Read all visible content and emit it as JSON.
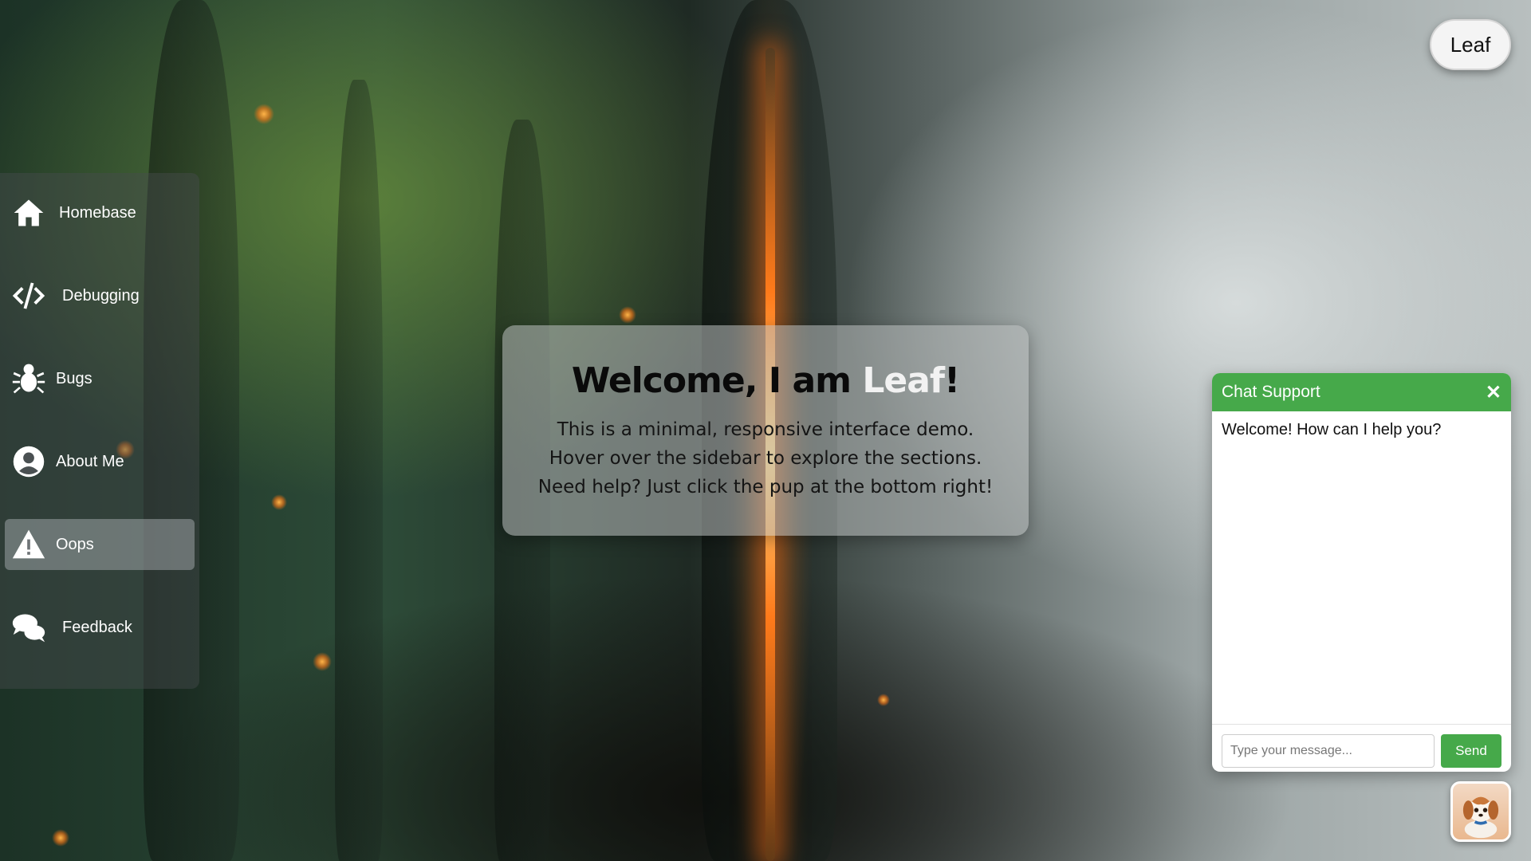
{
  "badge": {
    "label": "Leaf"
  },
  "sidebar": {
    "items": [
      {
        "label": "Homebase",
        "icon": "home-icon"
      },
      {
        "label": "Debugging",
        "icon": "code-icon"
      },
      {
        "label": "Bugs",
        "icon": "bug-icon"
      },
      {
        "label": "About Me",
        "icon": "user-circle-icon"
      },
      {
        "label": "Oops",
        "icon": "warning-icon",
        "active": true
      },
      {
        "label": "Feedback",
        "icon": "comments-icon"
      }
    ]
  },
  "welcome": {
    "title_prefix": "Welcome, I am ",
    "title_highlight": "Leaf",
    "title_suffix": "!",
    "lines": [
      "This is a minimal, responsive interface demo.",
      "Hover over the sidebar to explore the sections.",
      "Need help? Just click the pup at the bottom right!"
    ]
  },
  "chat": {
    "title": "Chat Support",
    "close_label": "✕",
    "message": "Welcome! How can I help you?",
    "input_placeholder": "Type your message...",
    "send_label": "Send"
  },
  "pup": {
    "icon": "puppy-avatar-icon"
  },
  "colors": {
    "accent": "#46a94a",
    "sidebar_active": "#b4b9bc"
  }
}
